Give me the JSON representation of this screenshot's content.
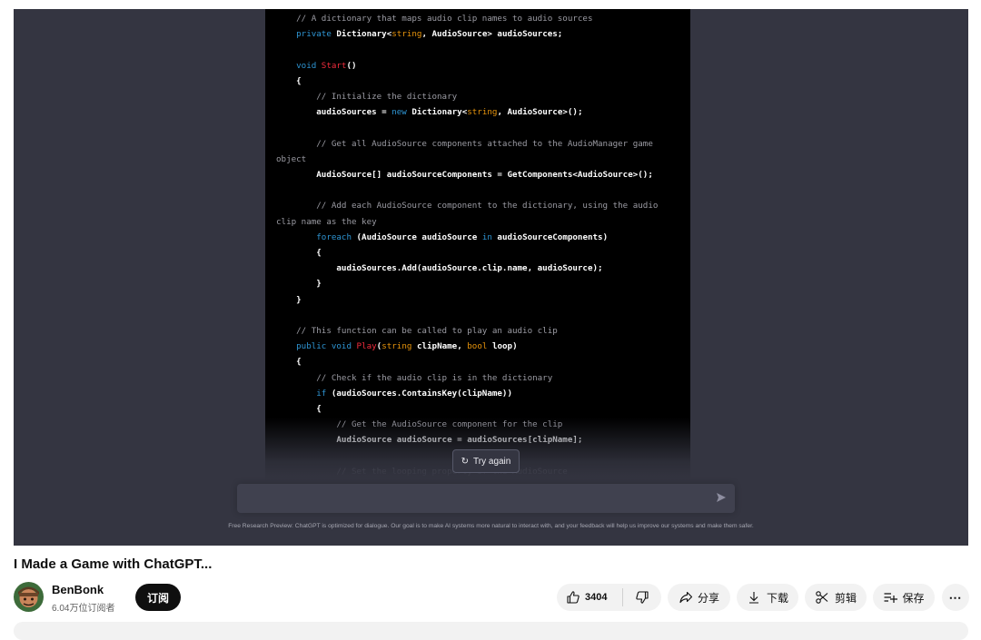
{
  "code_lines": [
    [
      {
        "c": "cm",
        "t": "    // A dictionary that maps audio clip names to audio sources"
      }
    ],
    [
      {
        "c": "kw",
        "t": "    private "
      },
      {
        "c": "tx",
        "t": "Dictionary<"
      },
      {
        "c": "st",
        "t": "string"
      },
      {
        "c": "tx",
        "t": ", AudioSource> audioSources;"
      }
    ],
    [],
    [
      {
        "c": "kw",
        "t": "    void "
      },
      {
        "c": "fn",
        "t": "Start"
      },
      {
        "c": "tx",
        "t": "()"
      }
    ],
    [
      {
        "c": "tx",
        "t": "    {"
      }
    ],
    [
      {
        "c": "cm",
        "t": "        // Initialize the dictionary"
      }
    ],
    [
      {
        "c": "tx",
        "t": "        audioSources = "
      },
      {
        "c": "kw",
        "t": "new "
      },
      {
        "c": "tx",
        "t": "Dictionary<"
      },
      {
        "c": "st",
        "t": "string"
      },
      {
        "c": "tx",
        "t": ", AudioSource>();"
      }
    ],
    [],
    [
      {
        "c": "cm",
        "t": "        // Get all AudioSource components attached to the AudioManager game"
      }
    ],
    [
      {
        "c": "cm",
        "t": "object"
      }
    ],
    [
      {
        "c": "tx",
        "t": "        AudioSource[] audioSourceComponents = GetComponents<AudioSource>();"
      }
    ],
    [],
    [
      {
        "c": "cm",
        "t": "        // Add each AudioSource component to the dictionary, using the audio"
      }
    ],
    [
      {
        "c": "cm",
        "t": "clip name as the key"
      }
    ],
    [
      {
        "c": "kw",
        "t": "        foreach "
      },
      {
        "c": "tx",
        "t": "(AudioSource audioSource "
      },
      {
        "c": "kw",
        "t": "in "
      },
      {
        "c": "tx",
        "t": "audioSourceComponents)"
      }
    ],
    [
      {
        "c": "tx",
        "t": "        {"
      }
    ],
    [
      {
        "c": "tx",
        "t": "            audioSources.Add(audioSource.clip.name, audioSource);"
      }
    ],
    [
      {
        "c": "tx",
        "t": "        }"
      }
    ],
    [
      {
        "c": "tx",
        "t": "    }"
      }
    ],
    [],
    [
      {
        "c": "cm",
        "t": "    // This function can be called to play an audio clip"
      }
    ],
    [
      {
        "c": "kw",
        "t": "    public void "
      },
      {
        "c": "fn",
        "t": "Play"
      },
      {
        "c": "tx",
        "t": "("
      },
      {
        "c": "st",
        "t": "string "
      },
      {
        "c": "tx",
        "t": "clipName, "
      },
      {
        "c": "st",
        "t": "bool "
      },
      {
        "c": "tx",
        "t": "loop)"
      }
    ],
    [
      {
        "c": "tx",
        "t": "    {"
      }
    ],
    [
      {
        "c": "cm",
        "t": "        // Check if the audio clip is in the dictionary"
      }
    ],
    [
      {
        "c": "kw",
        "t": "        if "
      },
      {
        "c": "tx",
        "t": "(audioSources.ContainsKey(clipName))"
      }
    ],
    [
      {
        "c": "tx",
        "t": "        {"
      }
    ],
    [
      {
        "c": "cm",
        "t": "            // Get the AudioSource component for the clip"
      }
    ],
    [
      {
        "c": "tx",
        "t": "            AudioSource audioSource = audioSources[clipName];"
      }
    ],
    [],
    [
      {
        "c": "cm",
        "t": "            // Set the looping property of the AudioSource"
      }
    ]
  ],
  "player": {
    "try_again_label": "Try again",
    "try_again_icon": "refresh-icon",
    "send_icon": "send-icon",
    "disclaimer": "Free Research Preview: ChatGPT is optimized for dialogue. Our goal is to make AI systems more natural to interact with, and your feedback will help us improve our systems and make them safer."
  },
  "video": {
    "title": "I Made a Game with ChatGPT..."
  },
  "channel": {
    "name": "BenBonk",
    "subscribers": "6.04万位订阅者",
    "subscribe_label": "订阅"
  },
  "actions": {
    "like_count": "3404",
    "share_label": "分享",
    "download_label": "下载",
    "clip_label": "剪辑",
    "save_label": "保存",
    "more_label": "⋯"
  },
  "colors": {
    "player_bg": "#343541",
    "code_bg": "#000000",
    "comment": "#9b9ba3",
    "keyword": "#2e95d3",
    "function": "#f22c3d",
    "string_type": "#e9950c"
  }
}
